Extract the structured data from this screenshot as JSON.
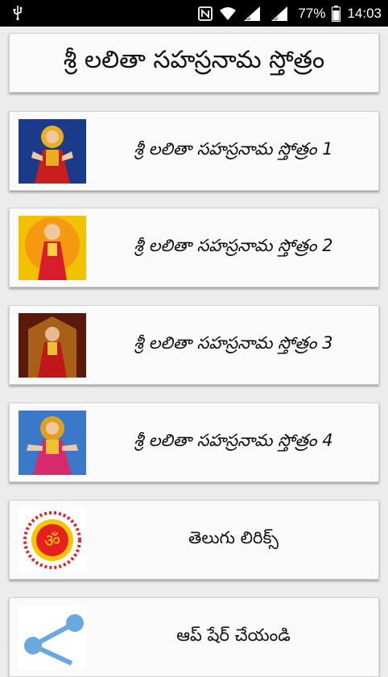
{
  "status_bar": {
    "battery_percent": "77%",
    "time": "14:03",
    "icons": [
      "usb-icon",
      "nfc-icon",
      "wifi-icon",
      "signal-icon",
      "signal-icon",
      "battery-icon"
    ]
  },
  "header": {
    "title": "శ్రీ లలితా సహస్రనామ స్తోత్రం"
  },
  "items": [
    {
      "label": "శ్రీ లలితా సహస్రనామ స్తోత్రం 1",
      "thumbnail": "goddess-image"
    },
    {
      "label": "శ్రీ లలితా సహస్రనామ స్తోత్రం 2",
      "thumbnail": "goddess-image"
    },
    {
      "label": "శ్రీ లలితా సహస్రనామ స్తోత్రం 3",
      "thumbnail": "goddess-image"
    },
    {
      "label": "శ్రీ లలితా సహస్రనామ స్తోత్రం 4",
      "thumbnail": "goddess-image"
    },
    {
      "label": "తెలుగు లిరిక్స్",
      "thumbnail": "om-icon"
    },
    {
      "label": "ఆప్ షేర్ చేయండి",
      "thumbnail": "share-icon"
    }
  ],
  "colors": {
    "background": "#ececec",
    "card": "#fafafa",
    "status_bar": "#000000"
  }
}
